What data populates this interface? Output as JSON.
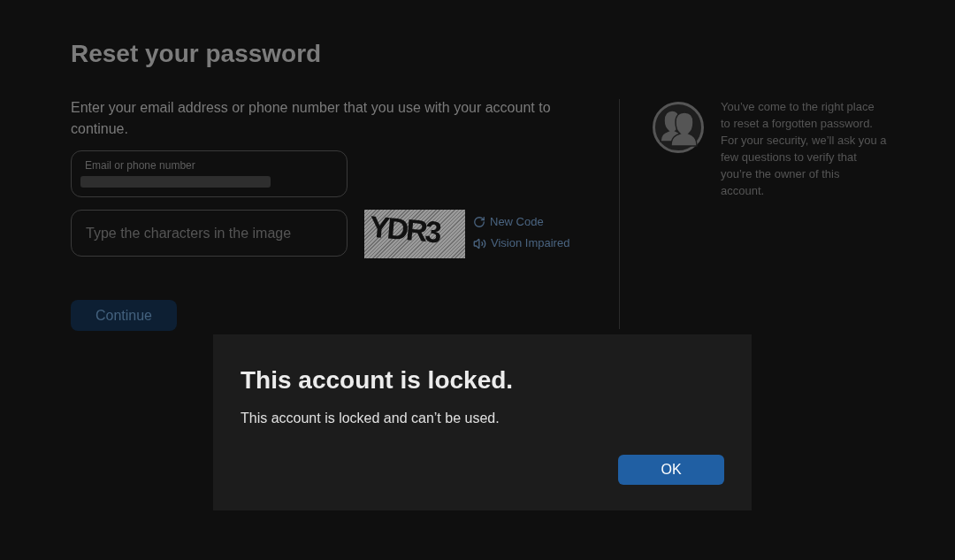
{
  "page": {
    "title": "Reset your password",
    "description": "Enter your email address or phone number that you use with your account to continue.",
    "email_field": {
      "label": "Email or phone number",
      "redacted": true
    },
    "captcha_field": {
      "placeholder": "Type the characters in the image"
    },
    "captcha": {
      "text": "YDR3"
    },
    "captcha_links": [
      {
        "kind": "refresh",
        "label": "New Code"
      },
      {
        "kind": "audio",
        "label": "Vision Impaired"
      }
    ],
    "continue_button": {
      "label": "Continue"
    }
  },
  "sidebar": {
    "lines": [
      "You’ve come to the right place",
      "to reset a forgotten password.",
      "For your security, we’ll ask you a",
      "few questions to verify that",
      "you’re the owner of this",
      "account."
    ]
  },
  "dialog": {
    "title": "This account is locked.",
    "message": "This account is locked and can’t be used.",
    "buttons": [
      "OK"
    ]
  }
}
